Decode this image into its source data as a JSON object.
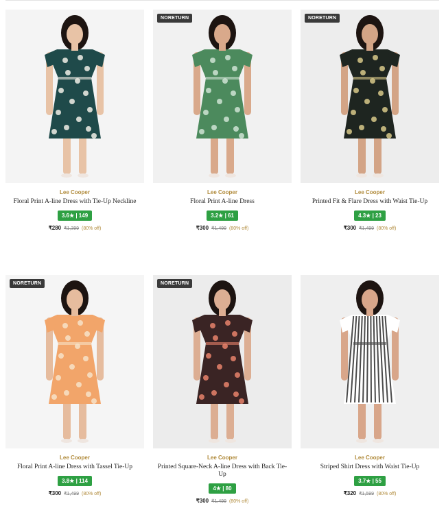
{
  "products": [
    {
      "badge": "",
      "brand": "Lee Cooper",
      "title": "Floral Print A-line Dress with Tie-Up Neckline",
      "rating": "3.6★ | 149",
      "price": "₹280",
      "mrp": "₹1,399",
      "discount": "(80% off)",
      "colors": {
        "bg": "#f4f4f4",
        "dress": "#1f4a4a",
        "print": "#f1eee6",
        "skin": "#e8c3a6"
      }
    },
    {
      "badge": "NORETURN",
      "brand": "Lee Cooper",
      "title": "Floral Print A-line Dress",
      "rating": "3.2★ | 61",
      "price": "₹300",
      "mrp": "₹1,499",
      "discount": "(80% off)",
      "colors": {
        "bg": "#f1f1f1",
        "dress": "#4c8a5d",
        "print": "#cfe3d3",
        "skin": "#d9a98b"
      }
    },
    {
      "badge": "NORETURN",
      "brand": "Lee Cooper",
      "title": "Printed Fit & Flare Dress with Waist Tie-Up",
      "rating": "4.3★ | 23",
      "price": "₹300",
      "mrp": "₹1,499",
      "discount": "(80% off)",
      "colors": {
        "bg": "#ededed",
        "dress": "#1e2520",
        "print": "#d8c98a",
        "skin": "#d3a486"
      }
    },
    {
      "badge": "NORETURN",
      "brand": "Lee Cooper",
      "title": "Floral Print A-line Dress with Tassel Tie-Up",
      "rating": "3.8★ | 114",
      "price": "₹300",
      "mrp": "₹1,499",
      "discount": "(80% off)",
      "colors": {
        "bg": "#f5f5f5",
        "dress": "#f2a56a",
        "print": "#f7e2c8",
        "skin": "#e6bc9e"
      }
    },
    {
      "badge": "NORETURN",
      "brand": "Lee Cooper",
      "title": "Printed Square-Neck A-line Dress with Back Tie-Up",
      "rating": "4★ | 80",
      "price": "₹300",
      "mrp": "₹1,499",
      "discount": "(80% off)",
      "colors": {
        "bg": "#ececec",
        "dress": "#3a2424",
        "print": "#e8826b",
        "skin": "#dcae93"
      }
    },
    {
      "badge": "",
      "brand": "Lee Cooper",
      "title": "Striped Shirt Dress with Waist Tie-Up",
      "rating": "3.7★ | 55",
      "price": "₹320",
      "mrp": "₹1,599",
      "discount": "(80% off)",
      "colors": {
        "bg": "#efefef",
        "dress": "#ffffff",
        "print": "#4a4a4a",
        "skin": "#d8a68a"
      }
    }
  ]
}
